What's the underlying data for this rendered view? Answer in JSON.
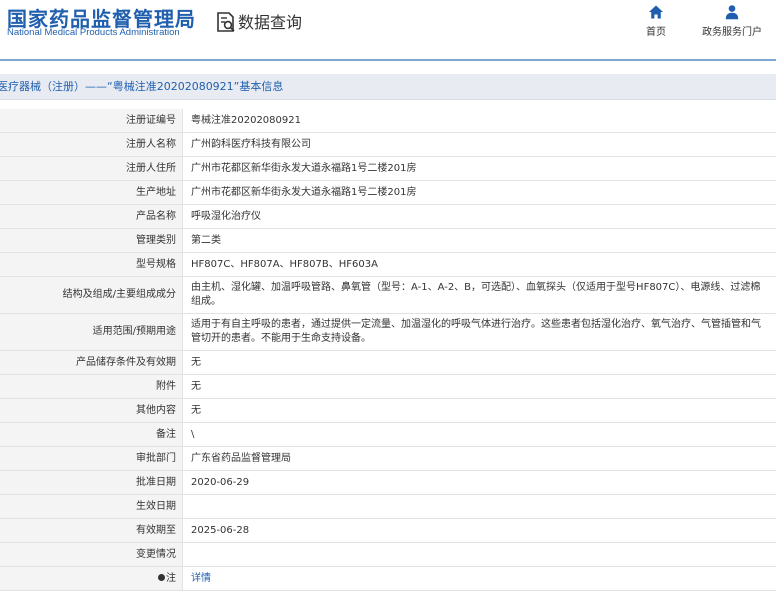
{
  "header": {
    "logo_cn": "国家药品监督管理局",
    "logo_en": "National Medical Products Administration",
    "query_title": "数据查询",
    "nav": [
      {
        "label": "首页",
        "icon": "home-icon"
      },
      {
        "label": "政务服务门户",
        "icon": "user-icon"
      }
    ]
  },
  "section": {
    "title": "医疗器械（注册）——“粤械注准20202080921”基本信息"
  },
  "rows": [
    {
      "label": "注册证编号",
      "value": "粤械注准20202080921"
    },
    {
      "label": "注册人名称",
      "value": "广州韵科医疗科技有限公司"
    },
    {
      "label": "注册人住所",
      "value": "广州市花都区新华街永发大道永福路1号二楼201房"
    },
    {
      "label": "生产地址",
      "value": "广州市花都区新华街永发大道永福路1号二楼201房"
    },
    {
      "label": "产品名称",
      "value": "呼吸湿化治疗仪"
    },
    {
      "label": "管理类别",
      "value": "第二类"
    },
    {
      "label": "型号规格",
      "value": "HF807C、HF807A、HF807B、HF603A"
    },
    {
      "label": "结构及组成/主要组成成分",
      "value": "由主机、湿化罐、加温呼吸管路、鼻氧管（型号：A-1、A-2、B，可选配）、血氧探头（仅适用于型号HF807C）、电源线、过滤棉组成。"
    },
    {
      "label": "适用范围/预期用途",
      "value": "适用于有自主呼吸的患者，通过提供一定流量、加温湿化的呼吸气体进行治疗。这些患者包括湿化治疗、氧气治疗、气管插管和气管切开的患者。不能用于生命支持设备。"
    },
    {
      "label": "产品储存条件及有效期",
      "value": "无"
    },
    {
      "label": "附件",
      "value": "无"
    },
    {
      "label": "其他内容",
      "value": "无"
    },
    {
      "label": "备注",
      "value": "\\"
    },
    {
      "label": "审批部门",
      "value": "广东省药品监督管理局"
    },
    {
      "label": "批准日期",
      "value": "2020-06-29"
    },
    {
      "label": "生效日期",
      "value": ""
    },
    {
      "label": "有效期至",
      "value": "2025-06-28"
    },
    {
      "label": "变更情况",
      "value": ""
    },
    {
      "label": "注",
      "value": "详情"
    }
  ],
  "colors": {
    "brand_blue": "#1f5fae",
    "label_bg": "#f4f4f4",
    "title_bar_bg": "#e8ecf2"
  }
}
